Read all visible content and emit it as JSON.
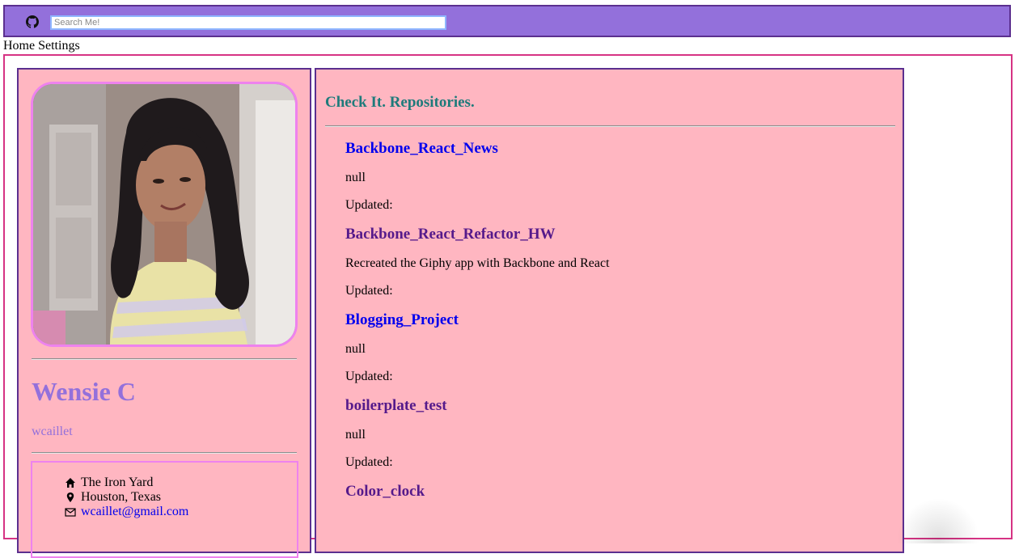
{
  "search": {
    "placeholder": "Search Me!"
  },
  "nav": {
    "links": [
      "Home",
      "Settings"
    ]
  },
  "profile": {
    "name": "Wensie C",
    "login": "wcaillet",
    "company": "The Iron Yard",
    "location": "Houston, Texas",
    "email": "wcaillet@gmail.com"
  },
  "repos": {
    "heading": "Check It. Repositories.",
    "items": [
      {
        "name": "Backbone_React_News",
        "description": "null",
        "updated": "Updated:",
        "state": "link"
      },
      {
        "name": "Backbone_React_Refactor_HW",
        "description": "Recreated the Giphy app with Backbone and React",
        "updated": "Updated:",
        "state": "visited"
      },
      {
        "name": "Blogging_Project",
        "description": "null",
        "updated": "Updated:",
        "state": "link"
      },
      {
        "name": "boilerplate_test",
        "description": "null",
        "updated": "Updated:",
        "state": "visited"
      },
      {
        "name": "Color_clock",
        "description": "",
        "updated": "",
        "state": "visited"
      }
    ]
  },
  "colors": {
    "topbar": "#9370db",
    "panel": "#ffb6c1",
    "accent": "#ee82ee",
    "heading": "#1e7b7b",
    "link": "#0000ee",
    "visited": "#551a8b"
  },
  "icons": [
    "github-icon",
    "home-icon",
    "map-marker-icon",
    "envelope-icon"
  ]
}
